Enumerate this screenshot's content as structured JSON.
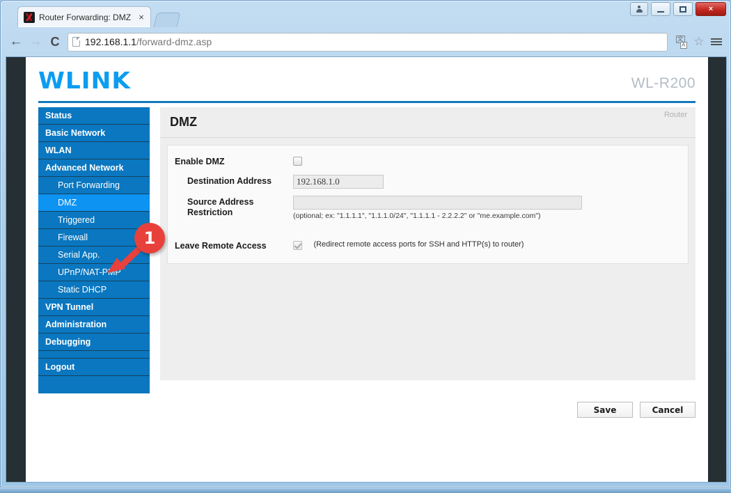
{
  "browser": {
    "tab_title": "Router Forwarding: DMZ",
    "tab_close": "×",
    "favicon": "router-favicon",
    "back_glyph": "←",
    "forward_glyph": "→",
    "reload_glyph": "C",
    "url_host": "192.168.1.1",
    "url_path": "/forward-dmz.asp",
    "star_glyph": "☆",
    "window_buttons": {
      "user": "user-icon",
      "minimize": "minimize-icon",
      "maximize": "maximize-icon",
      "close": "×"
    }
  },
  "router": {
    "brand": "WLINK",
    "model": "WL-R200"
  },
  "sidebar": {
    "items": [
      {
        "label": "Status",
        "level": "top",
        "active": false
      },
      {
        "label": "Basic Network",
        "level": "top",
        "active": false
      },
      {
        "label": "WLAN",
        "level": "top",
        "active": false
      },
      {
        "label": "Advanced Network",
        "level": "top",
        "active": false
      },
      {
        "label": "Port Forwarding",
        "level": "sub",
        "active": false
      },
      {
        "label": "DMZ",
        "level": "sub",
        "active": true
      },
      {
        "label": "Triggered",
        "level": "sub",
        "active": false
      },
      {
        "label": "Firewall",
        "level": "sub",
        "active": false
      },
      {
        "label": "Serial App.",
        "level": "sub",
        "active": false
      },
      {
        "label": "UPnP/NAT-PMP",
        "level": "sub",
        "active": false
      },
      {
        "label": "Static DHCP",
        "level": "sub",
        "active": false
      },
      {
        "label": "VPN Tunnel",
        "level": "top",
        "active": false
      },
      {
        "label": "Administration",
        "level": "top",
        "active": false
      },
      {
        "label": "Debugging",
        "level": "top",
        "active": false
      },
      {
        "label": "Logout",
        "level": "top",
        "active": false
      }
    ]
  },
  "content": {
    "title": "DMZ",
    "tag": "Router",
    "fields": {
      "enable_dmz_label": "Enable DMZ",
      "enable_dmz_checked": false,
      "destination_label": "Destination Address",
      "destination_value": "192.168.1.0",
      "destination_placeholder": "",
      "source_label": "Source Address Restriction",
      "source_value": "",
      "source_placeholder": "",
      "source_hint": "(optional; ex: \"1.1.1.1\", \"1.1.1.0/24\", \"1.1.1.1 - 2.2.2.2\" or \"me.example.com\")",
      "remote_access_label": "Leave Remote Access",
      "remote_access_checked": true,
      "remote_access_note": "(Redirect remote access ports for SSH and HTTP(s) to router)"
    }
  },
  "footer": {
    "save_label": "Save",
    "cancel_label": "Cancel"
  },
  "annotation": {
    "badge_number": "1"
  },
  "colors": {
    "brand_blue": "#0b9df0",
    "sidebar_blue": "#0a77c0",
    "sidebar_active": "#0d93f2",
    "header_rule": "#1278be",
    "annotation_red": "#e8413c",
    "page_dark": "#262f33"
  }
}
